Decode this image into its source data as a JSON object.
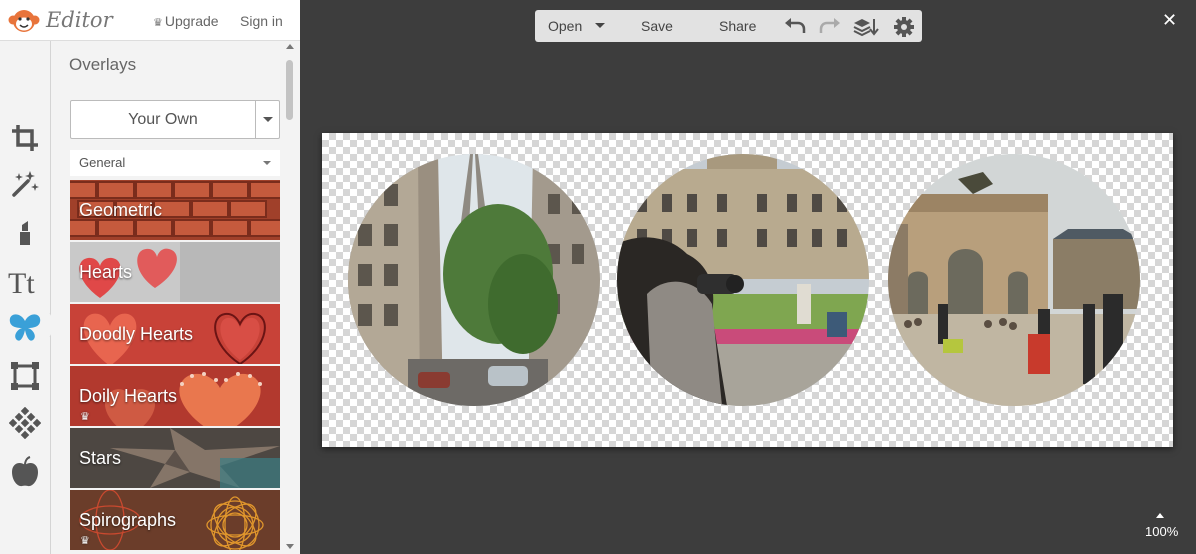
{
  "app": {
    "logo_text": "Editor",
    "upgrade_label": "Upgrade",
    "signin_label": "Sign in"
  },
  "toolbar": {
    "tools": [
      "crop-tool",
      "effects-tool",
      "touch-up-tool",
      "text-tool",
      "overlays-tool",
      "frames-tool",
      "textures-tool",
      "themes-tool"
    ],
    "active": "overlays-tool"
  },
  "sidebar": {
    "title": "Overlays",
    "your_own_label": "Your Own",
    "category_selected": "General",
    "items": [
      {
        "label": "Geometric",
        "premium": false
      },
      {
        "label": "Hearts",
        "premium": false
      },
      {
        "label": "Doodly Hearts",
        "premium": false
      },
      {
        "label": "Doily Hearts",
        "premium": true
      },
      {
        "label": "Stars",
        "premium": false
      },
      {
        "label": "Spirographs",
        "premium": true
      }
    ]
  },
  "edit_bar": {
    "open_label": "Open",
    "save_label": "Save",
    "share_label": "Share"
  },
  "canvas": {
    "photos": [
      "eiffel-tower-street",
      "palace-garden-photographer",
      "arc-de-triomphe-carrousel"
    ]
  },
  "zoom": {
    "value_label": "100%"
  },
  "colors": {
    "accent": "#e8743b",
    "panel_bg": "#f3f3f3",
    "workspace_bg": "#3d3d3d",
    "toolbar_icon": "#555555",
    "active_icon": "#3aa0d8"
  }
}
